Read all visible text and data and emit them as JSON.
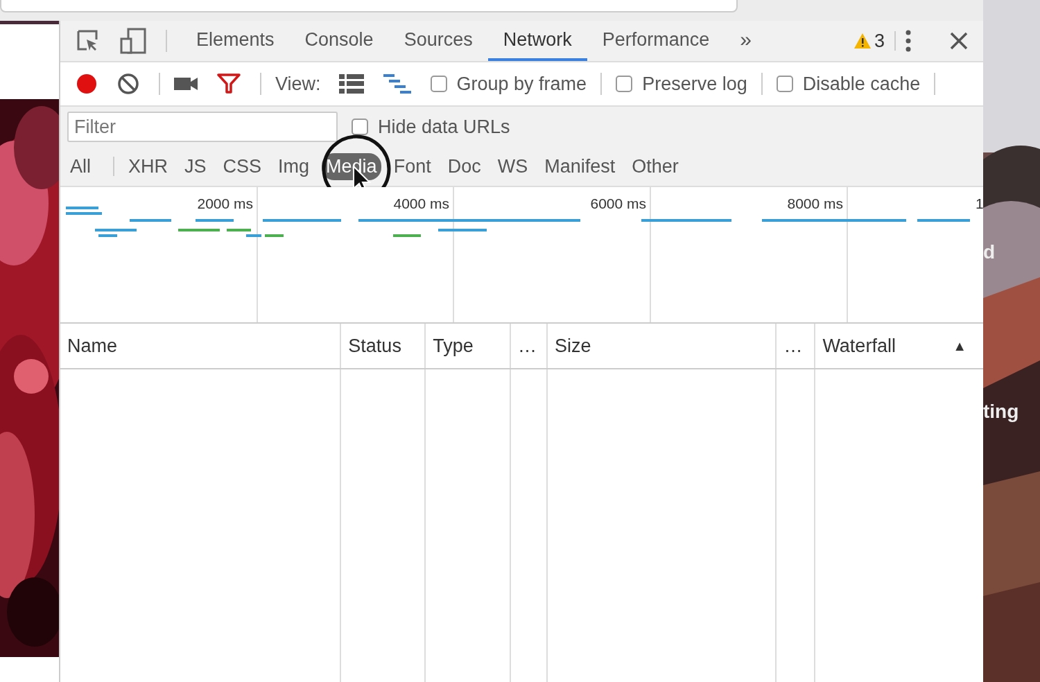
{
  "tabs": [
    {
      "label": "Elements",
      "selected": false
    },
    {
      "label": "Console",
      "selected": false
    },
    {
      "label": "Sources",
      "selected": false
    },
    {
      "label": "Network",
      "selected": true
    },
    {
      "label": "Performance",
      "selected": false
    }
  ],
  "more_tabs": "»",
  "warnings": "3",
  "toolbar": {
    "recording": true,
    "filter_active": true,
    "view_label": "View:",
    "options": [
      {
        "label": "Group by frame",
        "checked": false
      },
      {
        "label": "Preserve log",
        "checked": false
      },
      {
        "label": "Disable cache",
        "checked": false
      }
    ]
  },
  "filter": {
    "placeholder": "Filter",
    "hide_data_urls": {
      "label": "Hide data URLs",
      "checked": false
    }
  },
  "type_filters": [
    {
      "label": "All",
      "selected": false
    },
    {
      "label": "XHR",
      "selected": false
    },
    {
      "label": "JS",
      "selected": false
    },
    {
      "label": "CSS",
      "selected": false
    },
    {
      "label": "Img",
      "selected": false
    },
    {
      "label": "Media",
      "selected": true
    },
    {
      "label": "Font",
      "selected": false
    },
    {
      "label": "Doc",
      "selected": false
    },
    {
      "label": "WS",
      "selected": false
    },
    {
      "label": "Manifest",
      "selected": false
    },
    {
      "label": "Other",
      "selected": false
    }
  ],
  "overview_ticks": [
    "2000 ms",
    "4000 ms",
    "6000 ms",
    "8000 ms",
    "1"
  ],
  "table": {
    "columns": [
      "Name",
      "Status",
      "Type",
      "…",
      "Size",
      "…",
      "Waterfall"
    ],
    "sort_indicator": "▲"
  },
  "desktop_labels": [
    "d",
    "ting"
  ]
}
